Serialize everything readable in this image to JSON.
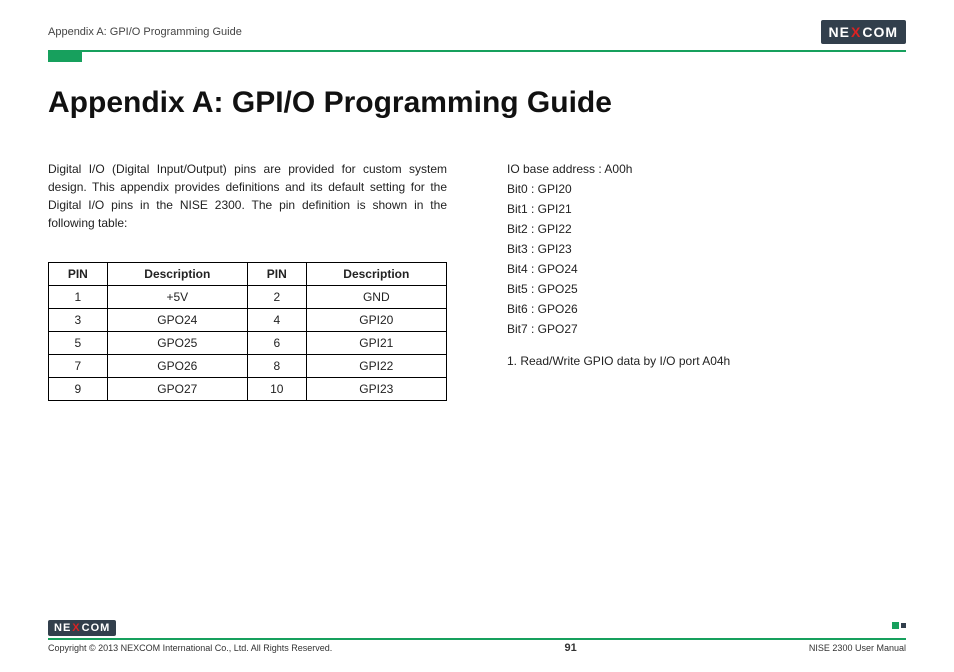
{
  "header": {
    "breadcrumb": "Appendix A: GPI/O Programming Guide",
    "brand_left": "NE",
    "brand_x": "X",
    "brand_right": "COM"
  },
  "title": "Appendix A: GPI/O Programming Guide",
  "intro": "Digital I/O (Digital Input/Output) pins are provided for custom system design. This appendix provides definitions and its default setting for the Digital I/O pins in the NISE 2300. The pin definition is shown in the following table:",
  "table": {
    "h_pin_a": "PIN",
    "h_desc_a": "Description",
    "h_pin_b": "PIN",
    "h_desc_b": "Description",
    "rows": [
      {
        "pa": "1",
        "da": "+5V",
        "pb": "2",
        "db": "GND"
      },
      {
        "pa": "3",
        "da": "GPO24",
        "pb": "4",
        "db": "GPI20"
      },
      {
        "pa": "5",
        "da": "GPO25",
        "pb": "6",
        "db": "GPI21"
      },
      {
        "pa": "7",
        "da": "GPO26",
        "pb": "8",
        "db": "GPI22"
      },
      {
        "pa": "9",
        "da": "GPO27",
        "pb": "10",
        "db": "GPI23"
      }
    ]
  },
  "io": {
    "base": "IO base address : A00h",
    "bits": [
      "Bit0 : GPI20",
      "Bit1 : GPI21",
      "Bit2 : GPI22",
      "Bit3 : GPI23",
      "Bit4 : GPO24",
      "Bit5 : GPO25",
      "Bit6 : GPO26",
      "Bit7 : GPO27"
    ],
    "note": "1. Read/Write GPIO data by I/O port A04h"
  },
  "footer": {
    "copyright": "Copyright © 2013 NEXCOM International Co., Ltd. All Rights Reserved.",
    "page": "91",
    "manual": "NISE 2300 User Manual"
  }
}
